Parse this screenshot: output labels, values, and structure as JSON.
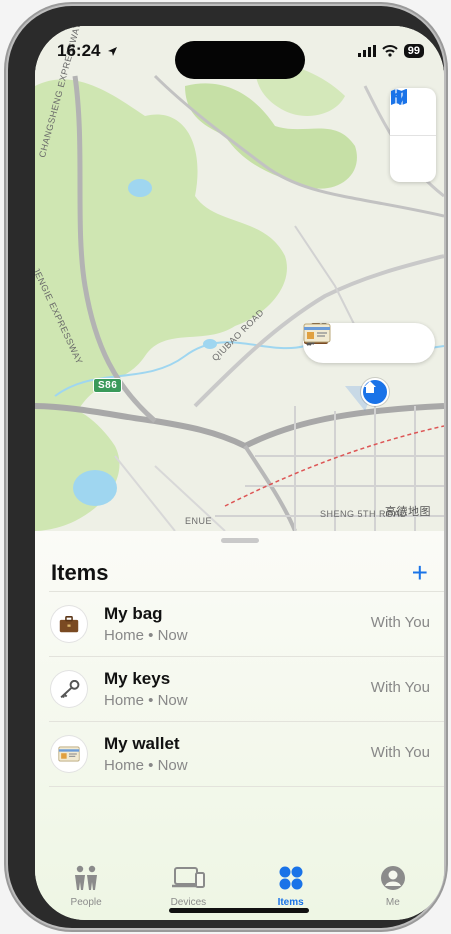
{
  "status_bar": {
    "time": "16:24",
    "battery": "99"
  },
  "map": {
    "labels": {
      "expressway1": "CHANGSHENG EXPRESSWAY",
      "expressway2": "JENGIE EXPRESSWAY",
      "qiubao": "QIUBAO ROAD",
      "route_badge": "S86",
      "sheng": "SHENG 5TH ROAD",
      "avenue": "ENUE",
      "watermark": "高德地图"
    },
    "cluster_icons": [
      "briefcase-icon",
      "key-icon",
      "id-card-icon"
    ]
  },
  "sheet": {
    "title": "Items",
    "add_label": "+",
    "items": [
      {
        "name": "My bag",
        "subtitle": "Home • Now",
        "status": "With You",
        "icon": "briefcase-icon"
      },
      {
        "name": "My keys",
        "subtitle": "Home • Now",
        "status": "With You",
        "icon": "key-icon"
      },
      {
        "name": "My wallet",
        "subtitle": "Home • Now",
        "status": "With You",
        "icon": "id-card-icon"
      }
    ]
  },
  "tabs": [
    {
      "label": "People",
      "icon": "people-icon",
      "active": false
    },
    {
      "label": "Devices",
      "icon": "devices-icon",
      "active": false
    },
    {
      "label": "Items",
      "icon": "items-icon",
      "active": true
    },
    {
      "label": "Me",
      "icon": "person-icon",
      "active": false
    }
  ],
  "colors": {
    "accent": "#1a73e8",
    "map_green": "#cfe6b2",
    "water": "#9fd6f0"
  }
}
